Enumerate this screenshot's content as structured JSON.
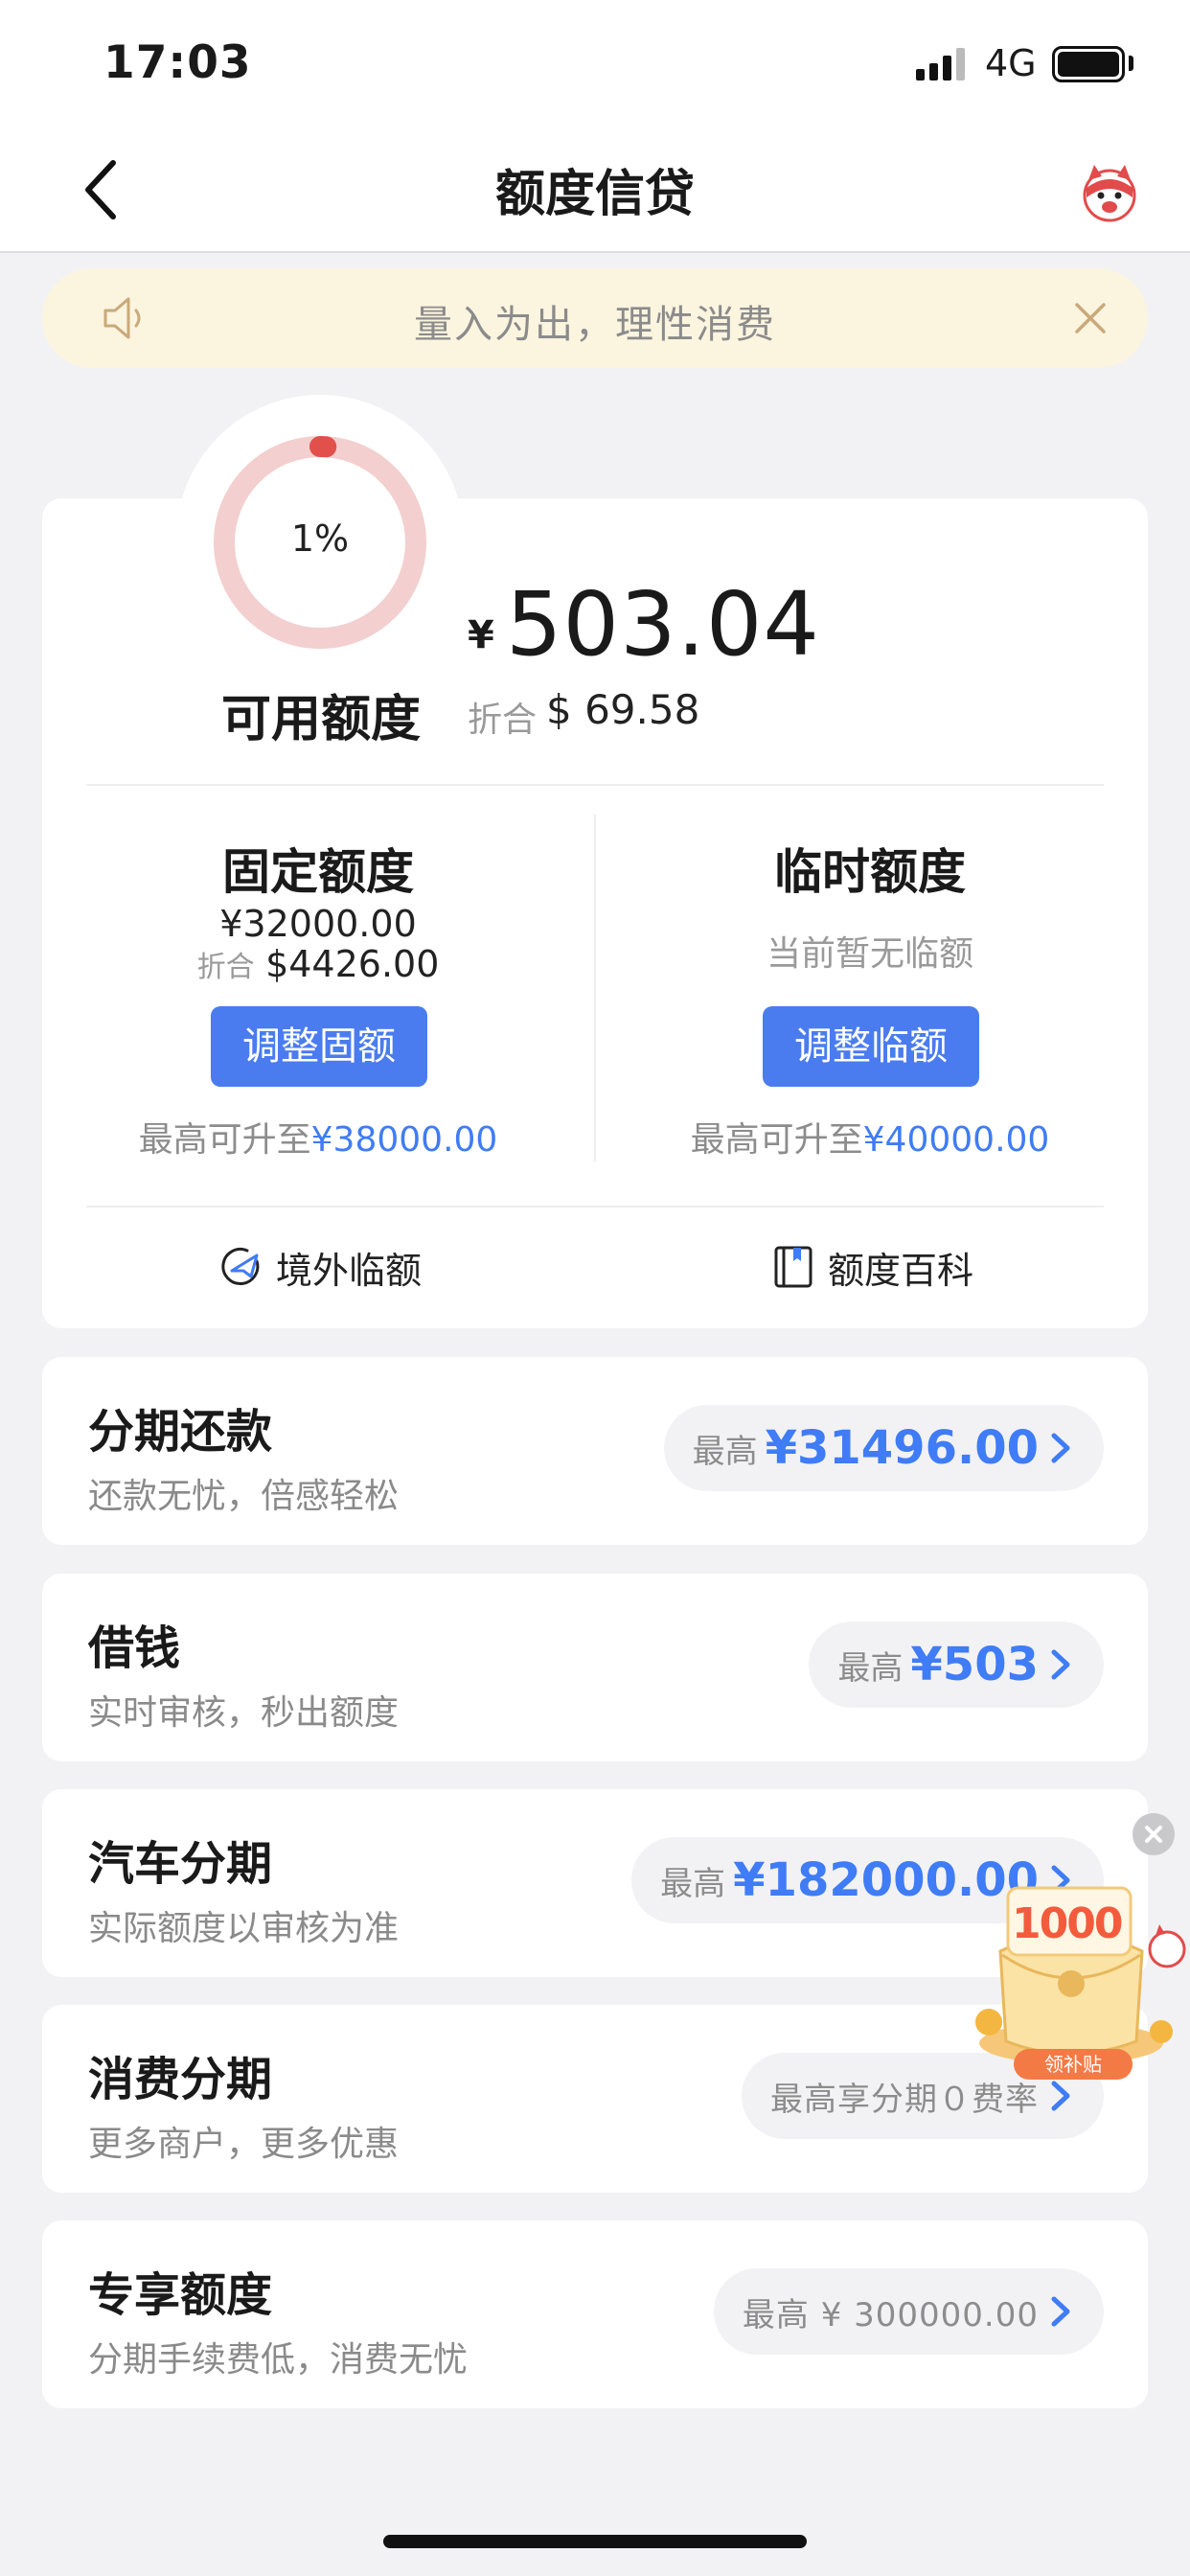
{
  "status_bar": {
    "time": "17:03",
    "network": "4G"
  },
  "nav": {
    "title": "额度信贷"
  },
  "notice": {
    "text": "量入为出，理性消费"
  },
  "quota": {
    "usage_percent_label": "1%",
    "usage_fraction": 0.01,
    "available_label": "可用额度",
    "currency_symbol": "¥",
    "available_amount": "503.04",
    "equiv_label": "折合",
    "equiv_value": "$ 69.58",
    "fixed": {
      "title": "固定额度",
      "amount": "¥32000.00",
      "equiv_label": "折合",
      "equiv_value": "$4426.00",
      "button": "调整固额",
      "max_prefix": "最高可升至",
      "max_value": "¥38000.00"
    },
    "temp": {
      "title": "临时额度",
      "status": "当前暂无临额",
      "button": "调整临额",
      "max_prefix": "最高可升至",
      "max_value": "¥40000.00"
    },
    "tools": [
      {
        "label": "境外临额",
        "icon": "airplane-globe-icon"
      },
      {
        "label": "额度百科",
        "icon": "book-icon"
      }
    ]
  },
  "products": [
    {
      "title": "分期还款",
      "subtitle": "还款无忧，倍感轻松",
      "prefix": "最高",
      "amount": "¥31496.00"
    },
    {
      "title": "借钱",
      "subtitle": "实时审核，秒出额度",
      "prefix": "最高",
      "amount": "¥503"
    },
    {
      "title": "汽车分期",
      "subtitle": "实际额度以审核为准",
      "prefix": "最高",
      "amount": "¥182000.00"
    },
    {
      "title": "消费分期",
      "subtitle": "更多商户，更多优惠",
      "text": "最高享分期０费率"
    },
    {
      "title": "专享额度",
      "subtitle": "分期手续费低，消费无忧",
      "text": "最高 ¥ 300000.00"
    }
  ],
  "floating_promo": {
    "badge": "1000",
    "tag": "领补贴"
  },
  "colors": {
    "accent_blue": "#4a7cf0",
    "link_blue": "#3f7cf5",
    "ring_red": "#e2504c",
    "ring_track": "#f3cfcf",
    "notice_bg": "#fbf4df"
  }
}
